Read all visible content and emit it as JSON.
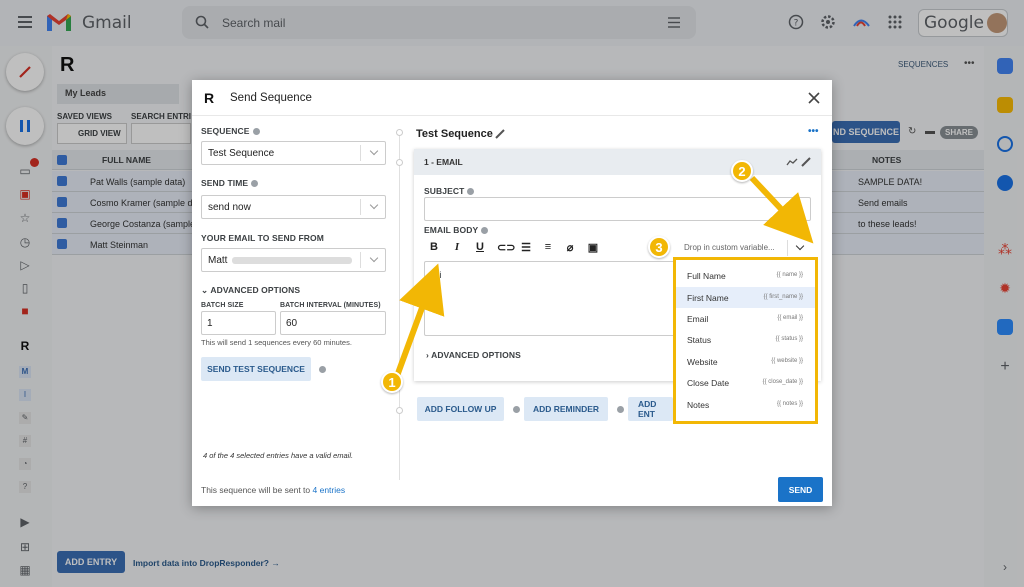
{
  "gmail": {
    "app_name": "Gmail",
    "search_placeholder": "Search mail",
    "google_label": "Google"
  },
  "app": {
    "sequences_link": "SEQUENCES",
    "tab_label": "My Leads",
    "saved_views_label": "SAVED VIEWS",
    "search_entries_label": "SEARCH ENTRI",
    "grid_view_label": "GRID VIEW",
    "send_sequence_btn": "ND SEQUENCE",
    "share_btn": "SHARE",
    "columns": {
      "full_name": "FULL NAME",
      "notes": "NOTES"
    },
    "rows": [
      {
        "name": "Pat Walls (sample data)",
        "notes": "SAMPLE DATA!"
      },
      {
        "name": "Cosmo Kramer (sample da",
        "notes": "Send emails"
      },
      {
        "name": "George Costanza (sample",
        "notes": "to these leads!"
      },
      {
        "name": "Matt Steinman",
        "notes": ""
      }
    ],
    "add_entry_btn": "ADD ENTRY",
    "import_link": "Import data into DropResponder? →"
  },
  "modal": {
    "title": "Send Sequence",
    "sequence_label": "SEQUENCE",
    "sequence_value": "Test Sequence",
    "send_time_label": "SEND TIME",
    "send_time_value": "send now",
    "from_label": "YOUR EMAIL TO SEND FROM",
    "from_value": "Matt",
    "advanced_options": "ADVANCED OPTIONS",
    "batch_size_label": "BATCH SIZE",
    "batch_size_value": "1",
    "batch_interval_label": "BATCH INTERVAL (MINUTES)",
    "batch_interval_value": "60",
    "batch_note": "This will send 1 sequences every 60 minutes.",
    "send_test_btn": "SEND TEST SEQUENCE",
    "valid_note": "4 of the 4 selected entries have a valid email.",
    "footer_note_prefix": "This sequence will be sent to ",
    "footer_note_link": "4 entries",
    "send_btn": "SEND",
    "sequence_name": "Test Sequence",
    "email_header": "1 - EMAIL",
    "subject_label": "SUBJECT",
    "body_label": "EMAIL BODY",
    "body_text": "Hi",
    "custom_var_placeholder": "Drop in custom variable...",
    "email_advanced": "ADVANCED OPTIONS",
    "add_follow_up": "ADD FOLLOW UP",
    "add_reminder": "ADD REMINDER",
    "add_entry_partial": "ADD ENT"
  },
  "dropdown_items": [
    {
      "label": "Full Name",
      "token": "{{ name }}"
    },
    {
      "label": "First Name",
      "token": "{{ first_name }}"
    },
    {
      "label": "Email",
      "token": "{{ email }}"
    },
    {
      "label": "Status",
      "token": "{{ status }}"
    },
    {
      "label": "Website",
      "token": "{{ website }}"
    },
    {
      "label": "Close Date",
      "token": "{{ close_date }}"
    },
    {
      "label": "Notes",
      "token": "{{ notes }}"
    }
  ],
  "callouts": [
    "1",
    "2",
    "3"
  ],
  "colors": {
    "highlight": "#f2b705",
    "primary": "#1a73c8",
    "gmail_red": "#ea4335"
  }
}
